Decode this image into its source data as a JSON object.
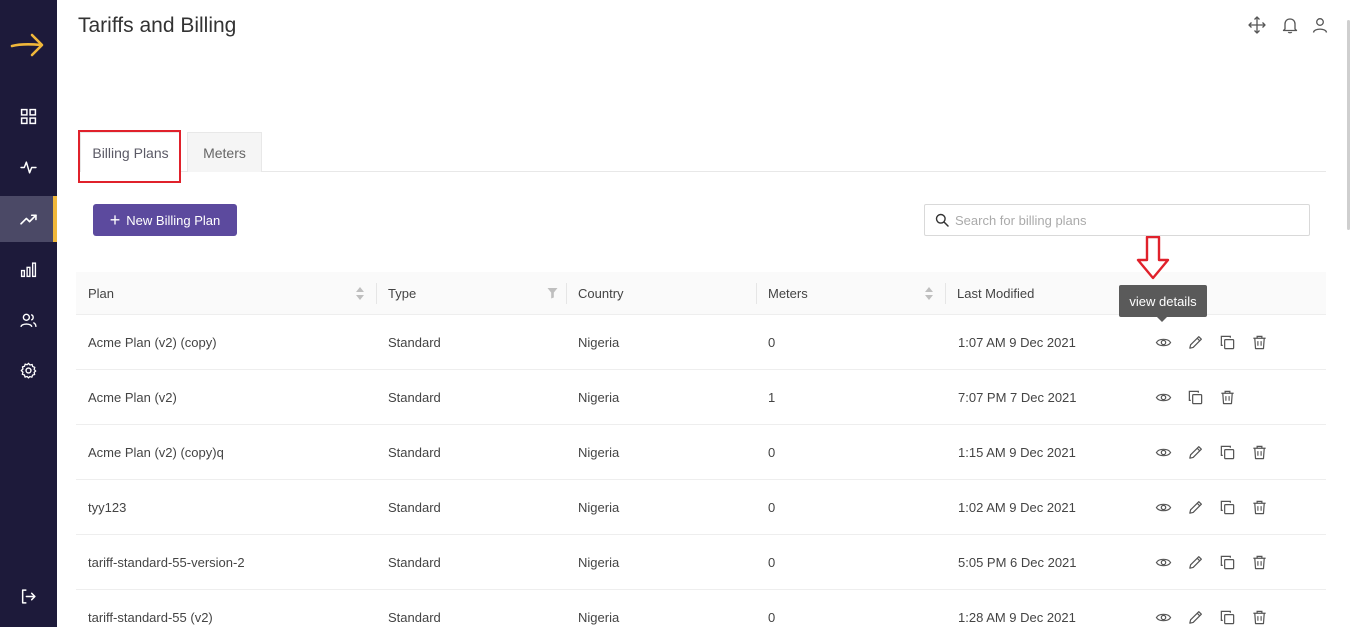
{
  "header": {
    "title": "Tariffs and Billing"
  },
  "tabs": [
    {
      "label": "Billing Plans",
      "active": true
    },
    {
      "label": "Meters",
      "active": false
    }
  ],
  "toolbar": {
    "new_button": "New Billing Plan",
    "search_placeholder": "Search for billing plans",
    "search_value": ""
  },
  "table": {
    "columns": [
      "Plan",
      "Type",
      "Country",
      "Meters",
      "Last Modified"
    ],
    "rows": [
      {
        "plan": "Acme Plan (v2) (copy)",
        "type": "Standard",
        "country": "Nigeria",
        "meters": "0",
        "modified": "1:07 AM 9 Dec 2021",
        "editable": true
      },
      {
        "plan": "Acme Plan (v2)",
        "type": "Standard",
        "country": "Nigeria",
        "meters": "1",
        "modified": "7:07 PM 7 Dec 2021",
        "editable": false
      },
      {
        "plan": "Acme Plan (v2) (copy)q",
        "type": "Standard",
        "country": "Nigeria",
        "meters": "0",
        "modified": "1:15 AM 9 Dec 2021",
        "editable": true
      },
      {
        "plan": "tyy123",
        "type": "Standard",
        "country": "Nigeria",
        "meters": "0",
        "modified": "1:02 AM 9 Dec 2021",
        "editable": true
      },
      {
        "plan": "tariff-standard-55-version-2",
        "type": "Standard",
        "country": "Nigeria",
        "meters": "0",
        "modified": "5:05 PM 6 Dec 2021",
        "editable": true
      },
      {
        "plan": "tariff-standard-55 (v2)",
        "type": "Standard",
        "country": "Nigeria",
        "meters": "0",
        "modified": "1:28 AM 9 Dec 2021",
        "editable": true
      }
    ]
  },
  "tooltip": {
    "text": "view details"
  },
  "sidebar": {
    "items": [
      {
        "icon": "dashboard-grid-icon"
      },
      {
        "icon": "activity-pulse-icon"
      },
      {
        "icon": "trending-up-icon",
        "active": true
      },
      {
        "icon": "bar-chart-icon"
      },
      {
        "icon": "users-icon"
      },
      {
        "icon": "gear-icon"
      }
    ],
    "bottom": {
      "icon": "logout-icon"
    }
  },
  "colors": {
    "sidebar_bg": "#1d1a3a",
    "accent": "#f0b73a",
    "primary_button": "#5c4a9e",
    "highlight": "#e0212b"
  }
}
